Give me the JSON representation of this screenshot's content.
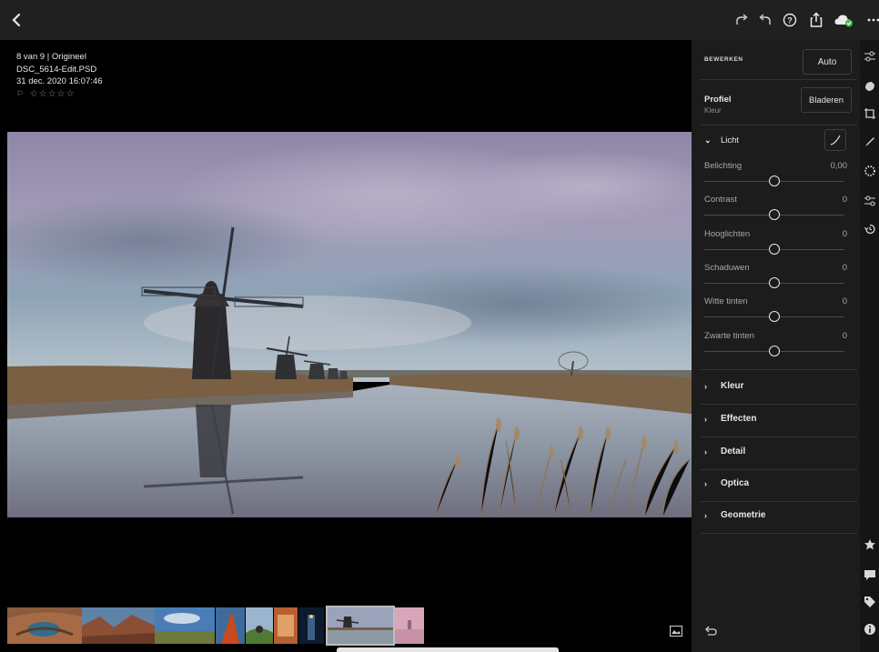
{
  "toolbar": {
    "back_icon": "chevron-left-icon",
    "redo_icon": "redo-icon",
    "undo_icon": "undo-icon",
    "help_icon": "help-circle-icon",
    "share_icon": "share-icon",
    "cloud_icon": "cloud-synced-icon",
    "more_icon": "more-horizontal-icon"
  },
  "info": {
    "position": "8 van 9 | Origineel",
    "filename": "DSC_5614-Edit.PSD",
    "datetime": "31 dec. 2020 16:07:46",
    "flag_glyph": "⚐",
    "stars": "☆☆☆☆☆",
    "rating": 0
  },
  "panel": {
    "header_label": "BEWERKEN",
    "auto_label": "Auto",
    "profile_label": "Profiel",
    "profile_value": "Kleur",
    "browse_label": "Bladeren",
    "light": {
      "label": "Licht",
      "sliders": [
        {
          "label": "Belichting",
          "value": "0,00",
          "position": 0.5
        },
        {
          "label": "Contrast",
          "value": "0",
          "position": 0.5
        },
        {
          "label": "Hooglichten",
          "value": "0",
          "position": 0.5
        },
        {
          "label": "Schaduwen",
          "value": "0",
          "position": 0.5
        },
        {
          "label": "Witte tinten",
          "value": "0",
          "position": 0.5
        },
        {
          "label": "Zwarte tinten",
          "value": "0",
          "position": 0.5
        }
      ]
    },
    "sections": [
      "Kleur",
      "Effecten",
      "Detail",
      "Optica",
      "Geometrie"
    ],
    "reset_icon": "reset-icon"
  },
  "tools": [
    "light-adjust-icon",
    "color-icon",
    "crop-icon",
    "brush-icon",
    "texture-icon",
    "selective-icon",
    "history-icon"
  ],
  "tools_bottom": [
    "star-icon",
    "comment-icon",
    "tag-icon",
    "info-icon"
  ],
  "filmstrip": {
    "selected_index": 8,
    "count": 10,
    "toggle_icon": "filmstrip-toggle-icon"
  },
  "colors": {
    "toolbar_bg": "#202020",
    "panel_bg": "#1c1c1c",
    "cloud_badge": "#3fb950"
  }
}
